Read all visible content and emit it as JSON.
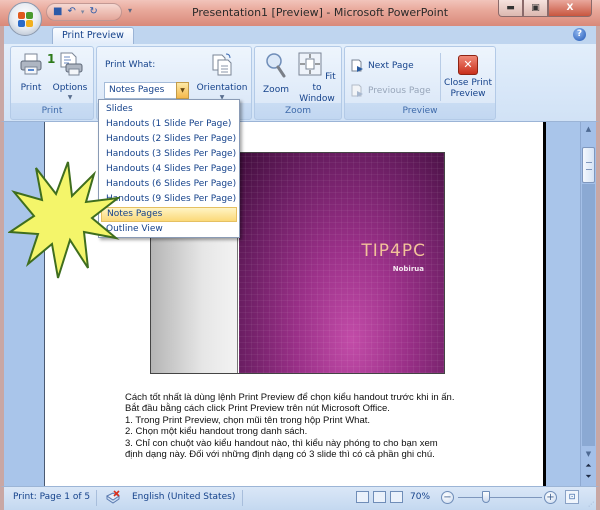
{
  "window": {
    "title": "Presentation1 [Preview] - Microsoft PowerPoint",
    "minimize_icon": "minimize-icon",
    "maximize_icon": "maximize-icon",
    "close_icon": "close-icon",
    "minimize_glyph": "▭",
    "maximize_glyph": "▢",
    "close_glyph": "X"
  },
  "quick_access": {
    "save_glyph": "💾",
    "undo_glyph": "↶",
    "undo_more_glyph": "▾",
    "redo_glyph": "↻",
    "customize_glyph": "▾"
  },
  "tabs": [
    {
      "label": "Print Preview",
      "active": true
    }
  ],
  "help_glyph": "?",
  "ribbon": {
    "groups": {
      "print": {
        "label": "Print",
        "print_button": "Print",
        "options_button": "Options"
      },
      "page_setup": {
        "print_what_label": "Print What:",
        "print_what_value": "Notes Pages",
        "orientation_button": "Orientation"
      },
      "zoom": {
        "label": "Zoom",
        "zoom_button": "Zoom",
        "fit_to_window_line1": "Fit to",
        "fit_to_window_line2": "Window"
      },
      "preview": {
        "label": "Preview",
        "next_page": "Next Page",
        "previous_page": "Previous Page",
        "previous_page_enabled": false,
        "close_line1": "Close Print",
        "close_line2": "Preview"
      }
    }
  },
  "dropdown": {
    "items": [
      {
        "label": "Slides",
        "selected": false
      },
      {
        "label": "Handouts (1 Slide Per Page)",
        "selected": false
      },
      {
        "label": "Handouts (2 Slides Per Page)",
        "selected": false
      },
      {
        "label": "Handouts (3 Slides Per Page)",
        "selected": false
      },
      {
        "label": "Handouts (4 Slides Per Page)",
        "selected": false
      },
      {
        "label": "Handouts (6 Slides Per Page)",
        "selected": false
      },
      {
        "label": "Handouts (9 Slides Per Page)",
        "selected": false
      },
      {
        "label": "Notes Pages",
        "selected": true
      },
      {
        "label": "Outline View",
        "selected": false
      }
    ]
  },
  "callout": {
    "number": "1"
  },
  "slide": {
    "title": "TIP4PC",
    "subtitle": "Nobirua"
  },
  "notes": [
    "Cách tốt nhất là dùng lệnh Print Preview để chọn kiểu handout trước khi in ấn.",
    "Bắt đầu bằng cách click Print Preview trên nút Microsoft Office.",
    "1. Trong Print Preview, chọn mũi tên trong hộp Print What.",
    "2. Chọn một kiểu handout trong danh sách.",
    "3. Chỉ con chuột vào kiểu handout nào, thì kiểu này phóng to cho bạn xem",
    "định dạng này. Đối với những định dạng có 3 slide thì có cả phần ghi chú."
  ],
  "statusbar": {
    "page_info": "Print: Page 1 of 5",
    "language": "English (United States)",
    "zoom_level": "70%",
    "zoom_percent": 70,
    "zoom_out_glyph": "−",
    "zoom_in_glyph": "+"
  },
  "colors": {
    "accent_text": "#15428b",
    "selected_item": "#fbd978",
    "callout_fill": "#f4f56a",
    "callout_stroke": "#3f6e1e",
    "slide_bg": "#9a3088"
  }
}
